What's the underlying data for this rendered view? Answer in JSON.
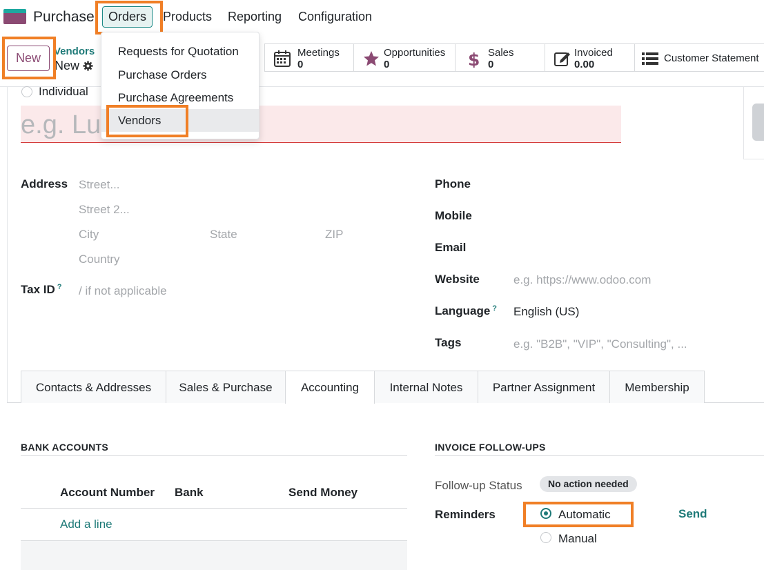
{
  "topnav": {
    "app_name": "Purchase",
    "menus": [
      "Orders",
      "Products",
      "Reporting",
      "Configuration"
    ]
  },
  "orders_menu": {
    "items": [
      "Requests for Quotation",
      "Purchase Orders",
      "Purchase Agreements",
      "Vendors"
    ]
  },
  "control_panel": {
    "new_label": "New",
    "breadcrumb_parent": "Vendors",
    "breadcrumb_current": "New"
  },
  "smart_buttons": [
    {
      "label": "Meetings",
      "value": "0",
      "icon": "calendar-icon"
    },
    {
      "label": "Opportunities",
      "value": "0",
      "icon": "star-icon"
    },
    {
      "label": "Sales",
      "value": "0",
      "icon": "dollar-icon"
    },
    {
      "label": "Invoiced",
      "value": "0.00",
      "icon": "pencil-square-icon"
    },
    {
      "label": "Customer Statement",
      "icon": "list-icon"
    }
  ],
  "form": {
    "individual_label": "Individual",
    "name_placeholder": "e.g. Lu",
    "address_label": "Address",
    "street_placeholder": "Street...",
    "street2_placeholder": "Street 2...",
    "city_placeholder": "City",
    "state_placeholder": "State",
    "zip_placeholder": "ZIP",
    "country_placeholder": "Country",
    "tax_id_label": "Tax ID",
    "tax_id_help": "?",
    "tax_id_placeholder": "/ if not applicable",
    "phone_label": "Phone",
    "mobile_label": "Mobile",
    "email_label": "Email",
    "website_label": "Website",
    "website_placeholder": "e.g. https://www.odoo.com",
    "language_label": "Language",
    "language_help": "?",
    "language_value": "English (US)",
    "tags_label": "Tags",
    "tags_placeholder": "e.g. \"B2B\", \"VIP\", \"Consulting\", ..."
  },
  "tabs": [
    "Contacts & Addresses",
    "Sales & Purchase",
    "Accounting",
    "Internal Notes",
    "Partner Assignment",
    "Membership"
  ],
  "accounting": {
    "bank_accounts_title": "BANK ACCOUNTS",
    "columns": [
      "Account Number",
      "Bank",
      "Send Money"
    ],
    "add_line": "Add a line",
    "followups_title": "INVOICE FOLLOW-UPS",
    "followup_status_label": "Follow-up Status",
    "followup_status_value": "No action needed",
    "reminders_label": "Reminders",
    "reminder_automatic": "Automatic",
    "reminder_manual": "Manual",
    "send_label": "Send"
  },
  "colors": {
    "brand": "#8b4a73",
    "accent": "#1e7a78",
    "highlight": "#f07f26"
  }
}
